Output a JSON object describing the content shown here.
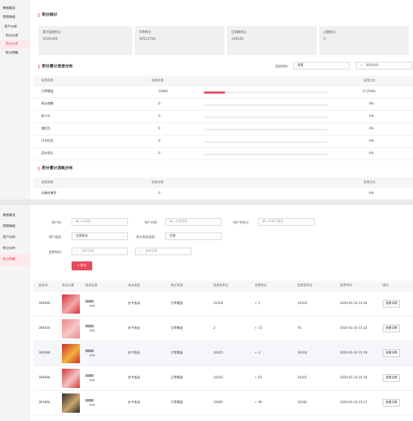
{
  "colors": {
    "accent": "#e84a5f",
    "sidebar_bg": "#f4f4f6",
    "card_bg": "#f0f0f2"
  },
  "panel1": {
    "sidebar": [
      "数据概览",
      "营销数据",
      "客户分析",
      "积分分析",
      "积分分布",
      "积分明细"
    ],
    "stats_title": "积分统计",
    "stats": [
      {
        "label": "累计发放积分",
        "value": "5320299"
      },
      {
        "label": "可用积分",
        "value": "30522762"
      },
      {
        "label": "已消耗积分",
        "value": "146181"
      },
      {
        "label": "过期积分",
        "value": "0"
      }
    ],
    "dist_title": "积分累计发放分布",
    "time_label": "选择时间:",
    "time_select": "月度",
    "month_value": "2020-01",
    "dist_headers": [
      "发放途径",
      "发放总值",
      "发放占比"
    ],
    "dist_rows": [
      {
        "channel": "订单赠送",
        "value": "22663",
        "pct": "17.254%",
        "ratio": 0.17254
      },
      {
        "channel": "积分调整",
        "value": "0",
        "pct": "0%",
        "ratio": 0
      },
      {
        "channel": "新人礼",
        "value": "0",
        "pct": "0%",
        "ratio": 0
      },
      {
        "channel": "福红包",
        "value": "0",
        "pct": "0%",
        "ratio": 0
      },
      {
        "channel": "口令红包",
        "value": "0",
        "pct": "0%",
        "ratio": 0
      },
      {
        "channel": "支付有礼",
        "value": "0",
        "pct": "0%",
        "ratio": 0
      }
    ],
    "consume_title": "积分累计消耗分布",
    "consume_headers": [
      "发放途径",
      "发放总值",
      "发放占比"
    ],
    "consume_rows": [
      {
        "channel": "兑换优惠券",
        "value": "0",
        "pct": "0%"
      }
    ]
  },
  "panel2": {
    "sidebar": [
      "数据概览",
      "营销数据",
      "客户分析",
      "积分分析",
      "积分明细"
    ],
    "filters": {
      "user_id_label": "用户ID:",
      "user_id_ph": "输入ID搜索",
      "user_name_label": "用户名称:",
      "user_name_ph": "输入名称搜索",
      "phone_label": "用户手机号:",
      "phone_ph": "输入手机号搜索",
      "user_type_label": "用户类型:",
      "user_type_value": "全部会员",
      "channel_label": "积分发放途径:",
      "channel_value": "全部",
      "time_label": "变更时间:",
      "start_ph": "选择日期",
      "end_ph": "选择日期",
      "query_label": "查询"
    },
    "table_headers": [
      "会员ID",
      "会员头像",
      "会员信息",
      "会员类型",
      "积分来源",
      "变更前积分",
      "变更积分",
      "变更后积分",
      "变更时间",
      "操作"
    ],
    "rows": [
      {
        "id": "390596",
        "type": "办卡会员",
        "source": "订单赠送",
        "before": "10318",
        "change": "+ 1",
        "after": "10319",
        "time": "2020-01-10 15:34",
        "action": "查看详情"
      },
      {
        "id": "390434",
        "type": "办卡会员",
        "source": "订单赠送",
        "before": "2",
        "change": "+ 72",
        "after": "76",
        "time": "2020-01-10 15:22",
        "action": "查看详情"
      },
      {
        "id": "390596",
        "type": "办卡会员",
        "source": "订单赠送",
        "before": "10315",
        "change": "+ 3",
        "after": "10318",
        "time": "2020-01-10 15:19",
        "action": "查看详情"
      },
      {
        "id": "390596",
        "type": "办卡会员",
        "source": "订单赠送",
        "before": "10252",
        "change": "+ 63",
        "after": "10315",
        "time": "2020-01-10 15:18",
        "action": "查看详情"
      },
      {
        "id": "391866",
        "type": "办卡会员",
        "source": "订单赠送",
        "before": "10092",
        "change": "+ 90",
        "after": "10182",
        "time": "2020-01-10 15:17",
        "action": "查看详情"
      }
    ]
  }
}
